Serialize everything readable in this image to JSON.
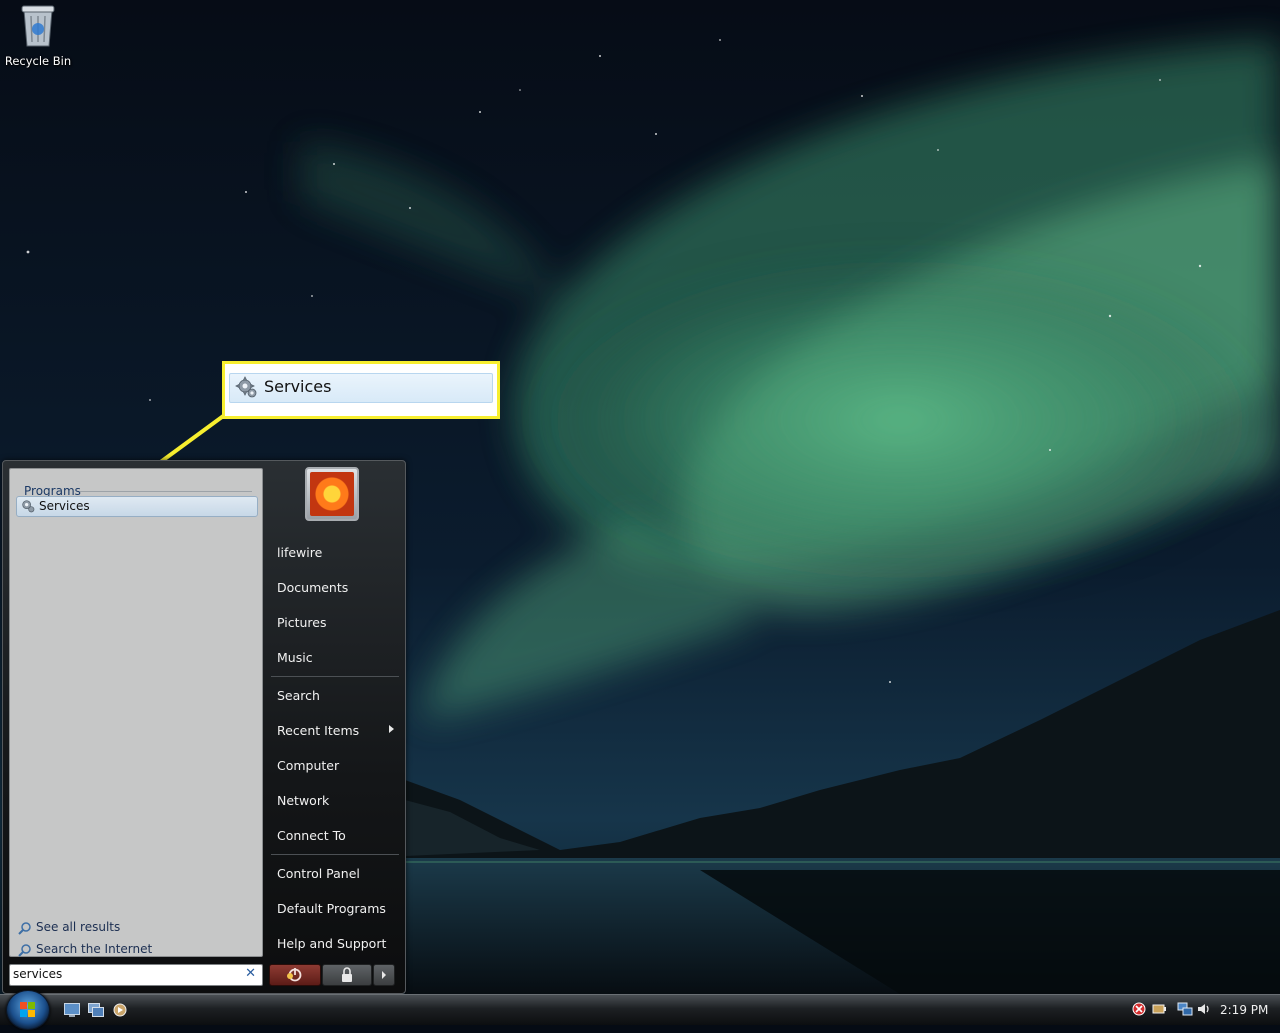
{
  "desktop": {
    "icons": [
      {
        "label": "Recycle Bin",
        "icon": "recycle-bin-icon"
      }
    ]
  },
  "callout": {
    "label": "Services",
    "icon": "gear-icon",
    "border_color": "#f7ee2f"
  },
  "start_menu": {
    "results_section_title": "Programs",
    "results": [
      {
        "label": "Services",
        "icon": "gear-icon"
      }
    ],
    "see_all_results": "See all results",
    "search_internet": "Search the Internet",
    "search_query": "services",
    "search_clear_glyph": "✕",
    "user_picture": "flower-picture",
    "right_column": [
      {
        "label": "lifewire"
      },
      {
        "label": "Documents"
      },
      {
        "label": "Pictures"
      },
      {
        "label": "Music"
      },
      {
        "label": "Search"
      },
      {
        "label": "Recent Items",
        "submenu": true
      },
      {
        "label": "Computer"
      },
      {
        "label": "Network"
      },
      {
        "label": "Connect To"
      },
      {
        "label": "Control Panel"
      },
      {
        "label": "Default Programs"
      },
      {
        "label": "Help and Support"
      }
    ]
  },
  "taskbar": {
    "start_orb": "windows-logo-icon",
    "quick_launch": [
      "show-desktop-icon",
      "switch-windows-icon",
      "media-player-icon"
    ],
    "tray_icons": [
      "security-alert-icon",
      "power-icon",
      "network-icon",
      "volume-icon"
    ],
    "clock": "2:19 PM"
  }
}
